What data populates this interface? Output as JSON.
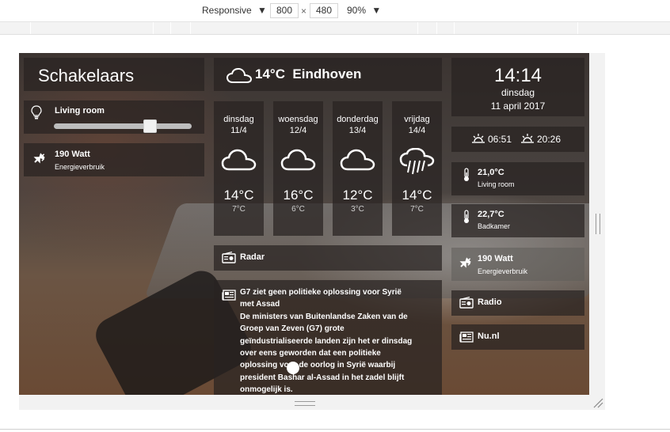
{
  "devtools": {
    "device_label": "Responsive",
    "width_value": "800",
    "times": "×",
    "height_value": "480",
    "zoom_label": "90%"
  },
  "switches": {
    "title": "Schakelaars",
    "living_room_label": "Living room",
    "living_room_level": 0.72,
    "power_value": "190 Watt",
    "power_sub": "Energieverbruik"
  },
  "weather": {
    "header": "14°C  Eindhoven",
    "days": [
      {
        "name": "dinsdag",
        "date": "11/4",
        "high": "14°C",
        "low": "7°C",
        "icon": "cloud-icon"
      },
      {
        "name": "woensdag",
        "date": "12/4",
        "high": "16°C",
        "low": "6°C",
        "icon": "cloud-icon"
      },
      {
        "name": "donderdag",
        "date": "13/4",
        "high": "12°C",
        "low": "3°C",
        "icon": "cloud-icon"
      },
      {
        "name": "vrijdag",
        "date": "14/4",
        "high": "14°C",
        "low": "7°C",
        "icon": "rain-icon"
      }
    ]
  },
  "radar_label": "Radar",
  "news": {
    "headline": "G7 ziet geen politieke oplossing voor Syrië met Assad",
    "body": "De ministers van Buitenlandse Zaken van de Groep van Zeven (G7) grote geïndustrialiseerde landen zijn het er dinsdag over eens geworden dat een politieke oplossing voor de oorlog in Syrië waarbij president Bashar al-Assad in het zadel blijft onmogelijk is."
  },
  "clock": {
    "time": "14:14",
    "day": "dinsdag",
    "date": "11 april 2017"
  },
  "sun": {
    "sunrise": "06:51",
    "sunset": "20:26"
  },
  "temps": [
    {
      "value": "21,0°C",
      "label": "Living room"
    },
    {
      "value": "22,7°C",
      "label": "Badkamer"
    }
  ],
  "right_power": {
    "value": "190 Watt",
    "sub": "Energieverbruik"
  },
  "radio_label": "Radio",
  "nunl_label": "Nu.nl"
}
